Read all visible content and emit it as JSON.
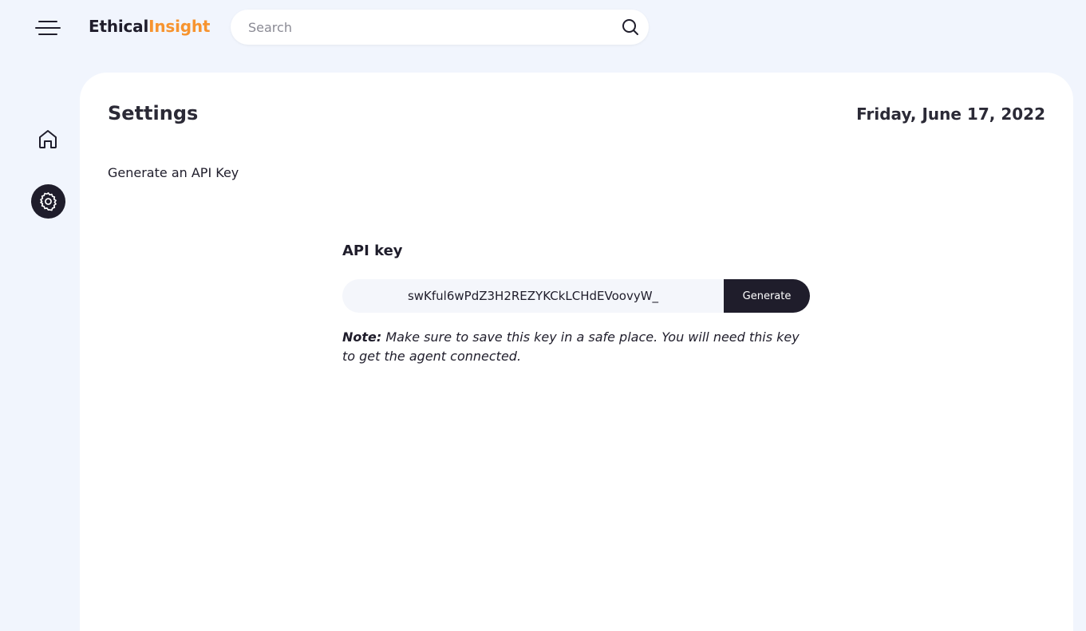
{
  "header": {
    "logo_part1": "Ethical",
    "logo_part2": "Insight",
    "search_placeholder": "Search"
  },
  "sidebar": {
    "items": [
      {
        "icon": "home-icon"
      },
      {
        "icon": "gear-icon",
        "active": true
      }
    ]
  },
  "page": {
    "title": "Settings",
    "date": "Friday, June 17, 2022",
    "subtitle": "Generate an API Key"
  },
  "api": {
    "label": "API key",
    "key_value": "swKful6wPdZ3H2REZYKCkLCHdEVoovyW_",
    "generate_label": "Generate",
    "note_bold": "Note:",
    "note_text": " Make sure to save this key in a safe place. You will need this key to get the agent connected."
  },
  "colors": {
    "accent": "#f7942f",
    "dark": "#1f1d2b",
    "background": "#f1f5fd"
  }
}
